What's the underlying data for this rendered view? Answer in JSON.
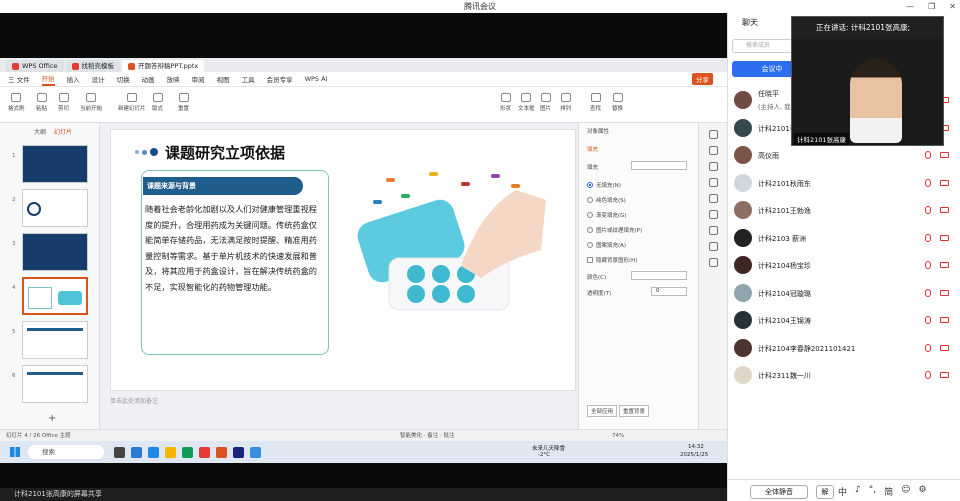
{
  "window": {
    "title": "腾讯会议",
    "min": "—",
    "max": "❐",
    "close": "✕"
  },
  "wps": {
    "tabs": [
      {
        "label": "WPS Office",
        "color": "#e53935"
      },
      {
        "label": "找稻壳模板",
        "color": "#e53935"
      },
      {
        "label": "开题答辩稿PPT.pptx",
        "color": "#d9541e"
      }
    ],
    "menu": [
      "三 文件",
      "开始",
      "插入",
      "设计",
      "切换",
      "动画",
      "放映",
      "审阅",
      "视图",
      "工具",
      "会员专享",
      "WPS AI"
    ],
    "menu_active": "开始",
    "share_btn": "分享",
    "ribbon": [
      "格式刷",
      "粘贴",
      "剪切",
      "当前开始",
      "新建幻灯片",
      "版式",
      "重置",
      "形状",
      "图片",
      "查找",
      "文本框",
      "排列",
      "替换"
    ],
    "left_tabs": [
      "大纲",
      "幻灯片"
    ],
    "slide_numbers": [
      "1",
      "2",
      "3",
      "4",
      "5",
      "6"
    ],
    "add_slide": "+",
    "notes_placeholder": "单击此处添加备注",
    "status": "幻灯片 4 / 26    Office 主题",
    "status_right": "智能美化 · 备注 · 批注",
    "zoom": "74%",
    "properties": {
      "title": "对象属性",
      "tab": "填充",
      "fill_label": "填充",
      "options": [
        "无填充(N)",
        "纯色填充(S)",
        "渐变填充(G)",
        "图片或纹理填充(P)",
        "图案填充(A)",
        "隐藏背景图形(H)"
      ],
      "color_label": "颜色(C)",
      "transparency_label": "透明度(T)",
      "transparency_value": "0",
      "apply_all": "全部应用",
      "reset_bg": "重置背景"
    }
  },
  "slide": {
    "title": "课题研究立项依据",
    "section": "课题来源与背景",
    "body": "随着社会老龄化加剧以及人们对健康管理重视程度的提升，合理用药成为关键问题。传统药盒仅能简单存储药品，无法满足按时提醒、精准用药量控制等需求。基于单片机技术的快速发展和普及，将其应用于药盒设计，旨在解决传统药盒的不足，实现智能化的药物管理功能。"
  },
  "taskbar": {
    "search": "搜索",
    "weather": "未来几天降雪",
    "temp": "-2°C",
    "time": "14:32",
    "date": "2025/1/25"
  },
  "bottom_banner": "计科2101张高康的屏幕共享",
  "chat": {
    "title": "聊天",
    "search_placeholder": "搜索成员",
    "mute_button": "会议中",
    "members": [
      {
        "name": "任晓平",
        "role": "(主持人, 我)",
        "avatar": "#6d4c41"
      },
      {
        "name": "计科2101张高康",
        "role": "",
        "avatar": "#37474f"
      },
      {
        "name": "高仪雨",
        "role": "",
        "avatar": "#795548"
      },
      {
        "name": "计科2101秋雨东",
        "role": "",
        "avatar": "#cfd8dc"
      },
      {
        "name": "计科2101王勃逸",
        "role": "",
        "avatar": "#8d6e63"
      },
      {
        "name": "计科2103 薪洲",
        "role": "",
        "avatar": "#212121"
      },
      {
        "name": "计科2104杨宝珍",
        "role": "",
        "avatar": "#3e2723"
      },
      {
        "name": "计科2104冠璇璐",
        "role": "",
        "avatar": "#90a4ae"
      },
      {
        "name": "计科2104王锦涛",
        "role": "",
        "avatar": "#263238"
      },
      {
        "name": "计科2104李春静2021101421",
        "role": "",
        "avatar": "#4e342e"
      },
      {
        "name": "计科2311魏一川",
        "role": "",
        "avatar": "#e0d7c6"
      }
    ],
    "mic_label": "静音",
    "cam_label": "视频",
    "footer": {
      "all_mute": "全体静音",
      "unmute": "解",
      "ime": [
        "中",
        "♪",
        "°,",
        "简",
        "☺",
        "⚙"
      ]
    }
  },
  "video": {
    "speaking": "正在讲话: 计科2101张高康;",
    "name_tag": "计科2101张高康"
  }
}
